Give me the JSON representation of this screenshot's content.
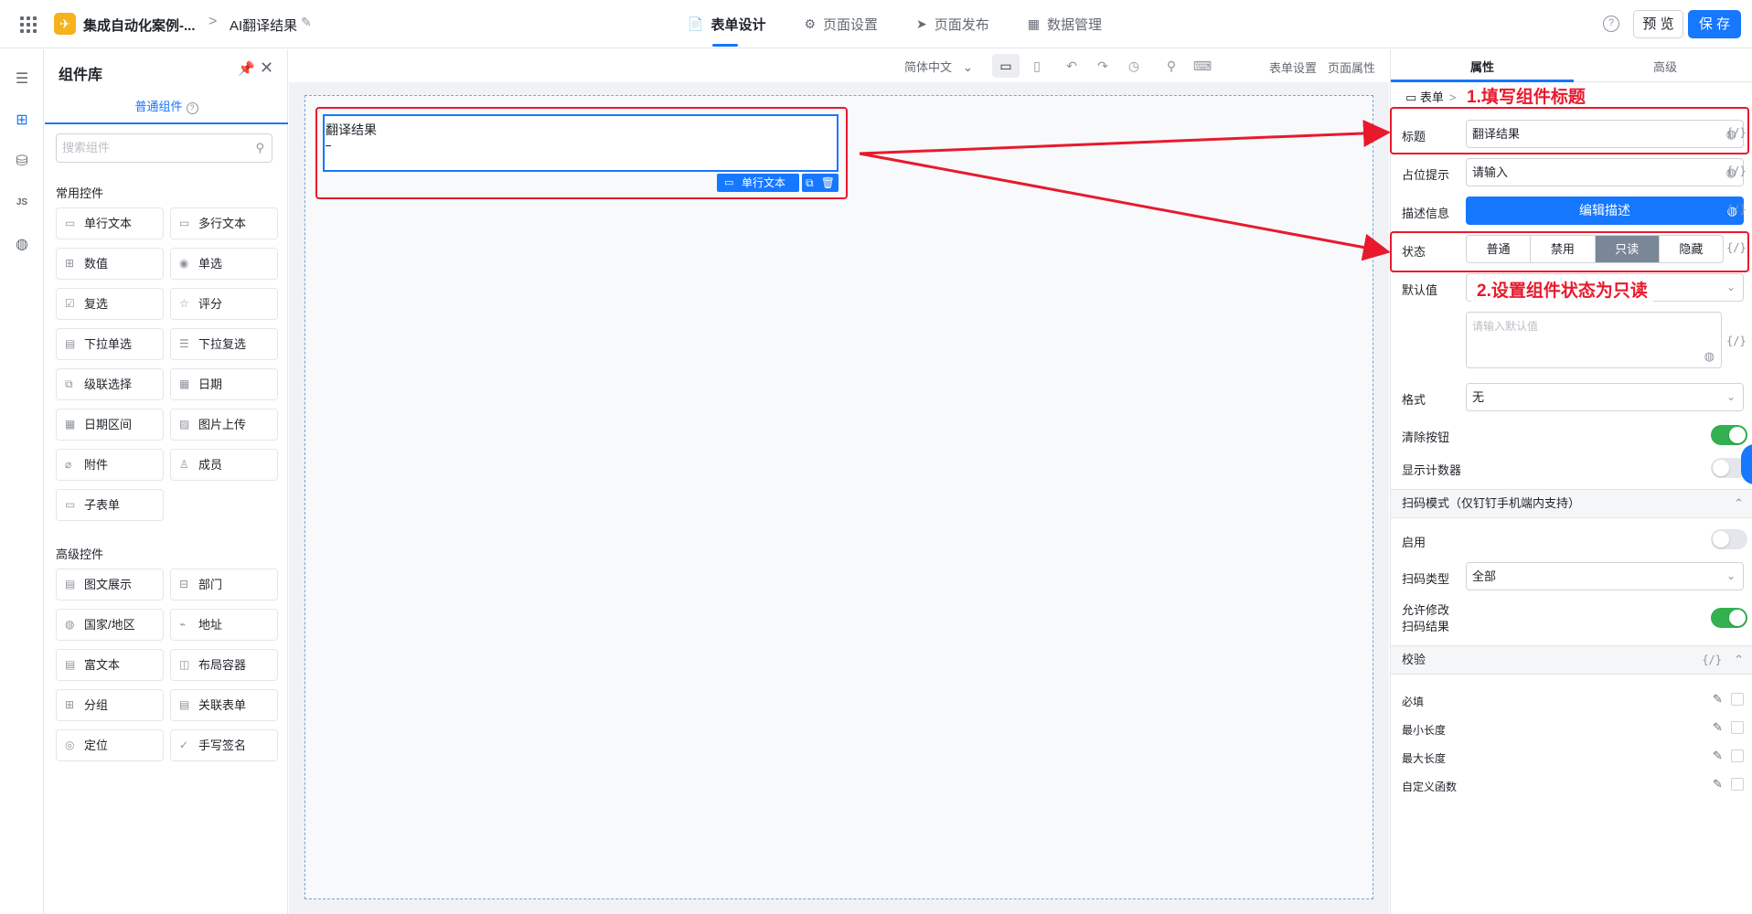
{
  "topbar": {
    "app_name": "集成自动化案例-...",
    "breadcrumb_sep": ">",
    "page_name": "AI翻译结果",
    "tabs": [
      {
        "label": "表单设计",
        "icon": "📄"
      },
      {
        "label": "页面设置",
        "icon": "⚙"
      },
      {
        "label": "页面发布",
        "icon": "➤"
      },
      {
        "label": "数据管理",
        "icon": "▦"
      }
    ],
    "help": "?",
    "preview_label": "预 览",
    "save_label": "保 存"
  },
  "library": {
    "title": "组件库",
    "tab_label": "普通组件",
    "search_placeholder": "搜索组件",
    "common_title": "常用控件",
    "common": [
      {
        "label": "单行文本",
        "icon": "▭"
      },
      {
        "label": "多行文本",
        "icon": "▭"
      },
      {
        "label": "数值",
        "icon": "⊞"
      },
      {
        "label": "单选",
        "icon": "◉"
      },
      {
        "label": "复选",
        "icon": "☑"
      },
      {
        "label": "评分",
        "icon": "☆"
      },
      {
        "label": "下拉单选",
        "icon": "▤"
      },
      {
        "label": "下拉复选",
        "icon": "☰"
      },
      {
        "label": "级联选择",
        "icon": "⧉"
      },
      {
        "label": "日期",
        "icon": "▦"
      },
      {
        "label": "日期区间",
        "icon": "▦"
      },
      {
        "label": "图片上传",
        "icon": "▨"
      },
      {
        "label": "附件",
        "icon": "⌀"
      },
      {
        "label": "成员",
        "icon": "♙"
      },
      {
        "label": "子表单",
        "icon": "▭"
      }
    ],
    "advanced_title": "高级控件",
    "advanced": [
      {
        "label": "图文展示",
        "icon": "▤"
      },
      {
        "label": "部门",
        "icon": "⊟"
      },
      {
        "label": "国家/地区",
        "icon": "◍"
      },
      {
        "label": "地址",
        "icon": "⌁"
      },
      {
        "label": "富文本",
        "icon": "▤"
      },
      {
        "label": "布局容器",
        "icon": "◫"
      },
      {
        "label": "分组",
        "icon": "⊞"
      },
      {
        "label": "关联表单",
        "icon": "▤"
      },
      {
        "label": "定位",
        "icon": "◎"
      },
      {
        "label": "手写签名",
        "icon": "✓"
      }
    ]
  },
  "toolbar": {
    "language": "简体中文",
    "form_settings": "表单设置",
    "page_props": "页面属性"
  },
  "canvas": {
    "field_label": "翻译结果",
    "field_type_tag": "单行文本"
  },
  "annotations": {
    "note1": "1.填写组件标题",
    "note2": "2.设置组件状态为只读"
  },
  "props": {
    "tab_props": "属性",
    "tab_advanced": "高级",
    "crumb_root": "表单",
    "title_label": "标题",
    "title_value": "翻译结果",
    "placeholder_label": "占位提示",
    "placeholder_value": "请输入",
    "desc_label": "描述信息",
    "desc_button": "编辑描述",
    "status_label": "状态",
    "status_options": [
      "普通",
      "禁用",
      "只读",
      "隐藏"
    ],
    "status_selected": "只读",
    "default_label": "默认值",
    "default_placeholder": "请输入默认值",
    "format_label": "格式",
    "format_value": "无",
    "clear_label": "清除按钮",
    "clear_on": true,
    "counter_label": "显示计数器",
    "counter_on": false,
    "scan_section": "扫码模式（仅钉钉手机端内支持）",
    "scan_enable_label": "启用",
    "scan_enable_on": false,
    "scan_type_label": "扫码类型",
    "scan_type_value": "全部",
    "scan_modify_label_1": "允许修改",
    "scan_modify_label_2": "扫码结果",
    "scan_modify_on": true,
    "validate_section": "校验",
    "validate_items": [
      "必填",
      "最小长度",
      "最大长度",
      "自定义函数"
    ],
    "fx": "{/}"
  }
}
